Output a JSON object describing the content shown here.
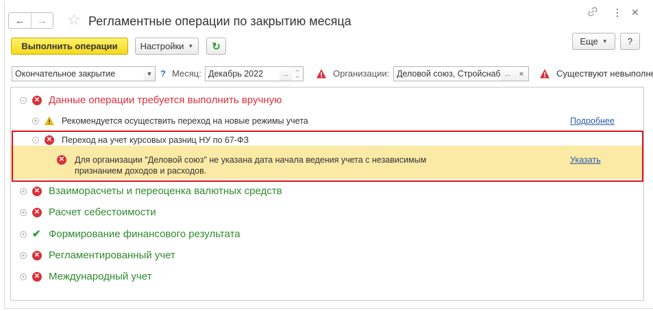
{
  "window": {
    "title": "Регламентные операции по закрытию месяца",
    "back_icon": "arrow-left-icon",
    "forward_icon": "arrow-right-icon",
    "favorite_icon": "star-icon",
    "link_icon": "link-icon",
    "menu_icon": "more-vertical-icon",
    "close_icon": "close-icon"
  },
  "toolbar": {
    "execute_label": "Выполнить операции",
    "settings_label": "Настройки",
    "refresh_icon": "refresh-icon",
    "more_label": "Еще",
    "help_label": "?"
  },
  "filters": {
    "mode_value": "Окончательное закрытие",
    "help_mark": "?",
    "month_label": "Месяц:",
    "month_value": "Декабрь 2022",
    "month_select": "...",
    "org_label": "Организации:",
    "org_value": "Деловой союз, Стройснаб",
    "org_select": "...",
    "org_clear": "×",
    "status_text": "Существуют невыполне"
  },
  "groups": [
    {
      "label": "Данные операции требуется выполнить вручную",
      "status": "error"
    },
    {
      "label": "Рекомендуется осуществить переход на новые режимы учета",
      "status": "warning",
      "link": "Подробнее"
    },
    {
      "label": "Переход на учет курсовых разниц НУ по 67-ФЗ",
      "status": "error"
    },
    {
      "label_line1": "Для организации \"Деловой союз\" не указана дата начала ведения учета с независимым",
      "label_line2": "признанием доходов и расходов.",
      "status": "error",
      "link": "Указать"
    },
    {
      "label": "Взаиморасчеты и переоценка валютных средств",
      "status": "error"
    },
    {
      "label": "Расчет себестоимости",
      "status": "error"
    },
    {
      "label": "Формирование финансового результата",
      "status": "ok"
    },
    {
      "label": "Регламентированный учет",
      "status": "error"
    },
    {
      "label": "Международный учет",
      "status": "error"
    }
  ],
  "colors": {
    "error": "#d9303a",
    "ok": "#2e8b2e",
    "highlight_border": "#e0141e",
    "warning_row_bg": "#fbe9a6",
    "primary_button": "#f4d91c"
  }
}
